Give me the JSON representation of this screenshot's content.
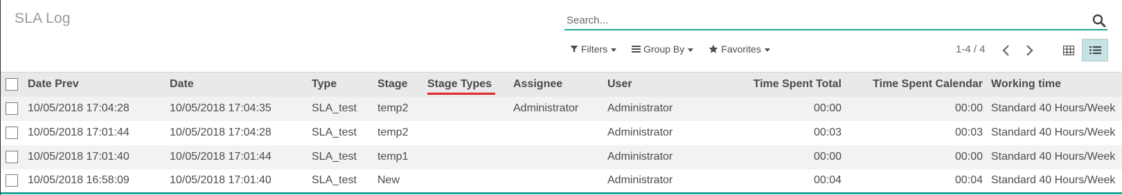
{
  "header": {
    "title": "SLA Log"
  },
  "search": {
    "placeholder": "Search...",
    "value": ""
  },
  "controls": {
    "filters_label": "Filters",
    "group_by_label": "Group By",
    "favorites_label": "Favorites"
  },
  "pager": {
    "text": "1-4 / 4"
  },
  "colors": {
    "accent": "#21a197",
    "active_view_bg": "#c7e2e2",
    "sort_underline": "#e0262a"
  },
  "icons": {
    "search": "search-icon",
    "filter": "filter-icon",
    "group_by": "bars-icon",
    "favorites": "star-icon",
    "prev": "chevron-left-icon",
    "next": "chevron-right-icon",
    "kanban": "grid-icon",
    "list": "list-icon"
  },
  "table": {
    "columns": [
      "Date Prev",
      "Date",
      "Type",
      "Stage",
      "Stage Types",
      "Assignee",
      "User",
      "Time Spent Total",
      "Time Spent Calendar",
      "Working time"
    ],
    "rows": [
      [
        "10/05/2018 17:04:28",
        "10/05/2018 17:04:35",
        "SLA_test",
        "temp2",
        "",
        "Administrator",
        "Administrator",
        "00:00",
        "00:00",
        "Standard 40 Hours/Week"
      ],
      [
        "10/05/2018 17:01:44",
        "10/05/2018 17:04:28",
        "SLA_test",
        "temp2",
        "",
        "",
        "Administrator",
        "00:03",
        "00:03",
        "Standard 40 Hours/Week"
      ],
      [
        "10/05/2018 17:01:40",
        "10/05/2018 17:01:44",
        "SLA_test",
        "temp1",
        "",
        "",
        "Administrator",
        "00:00",
        "00:00",
        "Standard 40 Hours/Week"
      ],
      [
        "10/05/2018 16:58:09",
        "10/05/2018 17:01:40",
        "SLA_test",
        "New",
        "",
        "",
        "Administrator",
        "00:04",
        "00:04",
        "Standard 40 Hours/Week"
      ]
    ]
  }
}
